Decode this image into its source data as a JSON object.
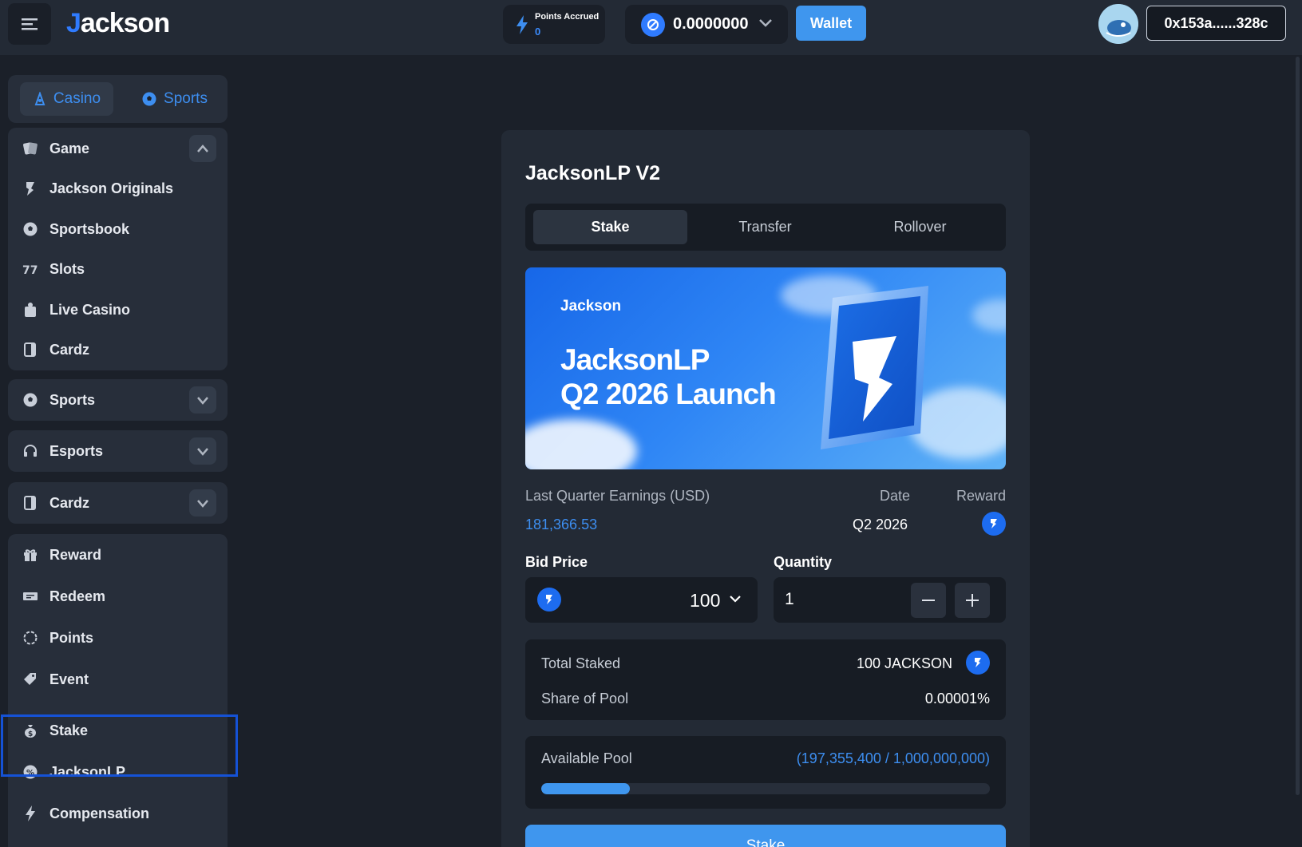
{
  "header": {
    "logo_text": "Jackson",
    "points_label": "Points Accrued",
    "points_value": "0",
    "balance": "0.0000000",
    "wallet_label": "Wallet",
    "address": "0x153a......328c"
  },
  "sidebar": {
    "toggle": {
      "casino": "Casino",
      "sports": "Sports"
    },
    "game_group": {
      "header": "Game",
      "items": [
        "Jackson Originals",
        "Sportsbook",
        "Slots",
        "Live Casino",
        "Cardz"
      ]
    },
    "collapsed_groups": [
      "Sports",
      "Esports",
      "Cardz"
    ],
    "misc_items": [
      "Reward",
      "Redeem",
      "Points",
      "Event"
    ],
    "stake_items": [
      "Stake",
      "JacksonLP",
      "Compensation"
    ]
  },
  "card": {
    "title": "JacksonLP V2",
    "tabs": [
      "Stake",
      "Transfer",
      "Rollover"
    ],
    "active_tab": "Stake",
    "banner": {
      "logo": "Jackson",
      "line1": "JacksonLP",
      "line2": "Q2 2026 Launch"
    },
    "earnings_label": "Last Quarter Earnings (USD)",
    "earnings_value": "181,366.53",
    "date_label": "Date",
    "date_value": "Q2 2026",
    "reward_label": "Reward",
    "bid_label": "Bid Price",
    "bid_value": "100",
    "qty_label": "Quantity",
    "qty_value": "1",
    "total_staked_label": "Total Staked",
    "total_staked_value": "100 JACKSON",
    "share_label": "Share of Pool",
    "share_value": "0.00001%",
    "pool_label": "Available Pool",
    "pool_value": "(197,355,400 / 1,000,000,000)",
    "pool_fill_fraction": 0.197,
    "stake_button": "Stake"
  },
  "colors": {
    "accent": "#3f96ee",
    "link": "#3d8ef0",
    "panel": "#232a35",
    "background": "#1b2029",
    "highlight_border": "#1552d6"
  }
}
